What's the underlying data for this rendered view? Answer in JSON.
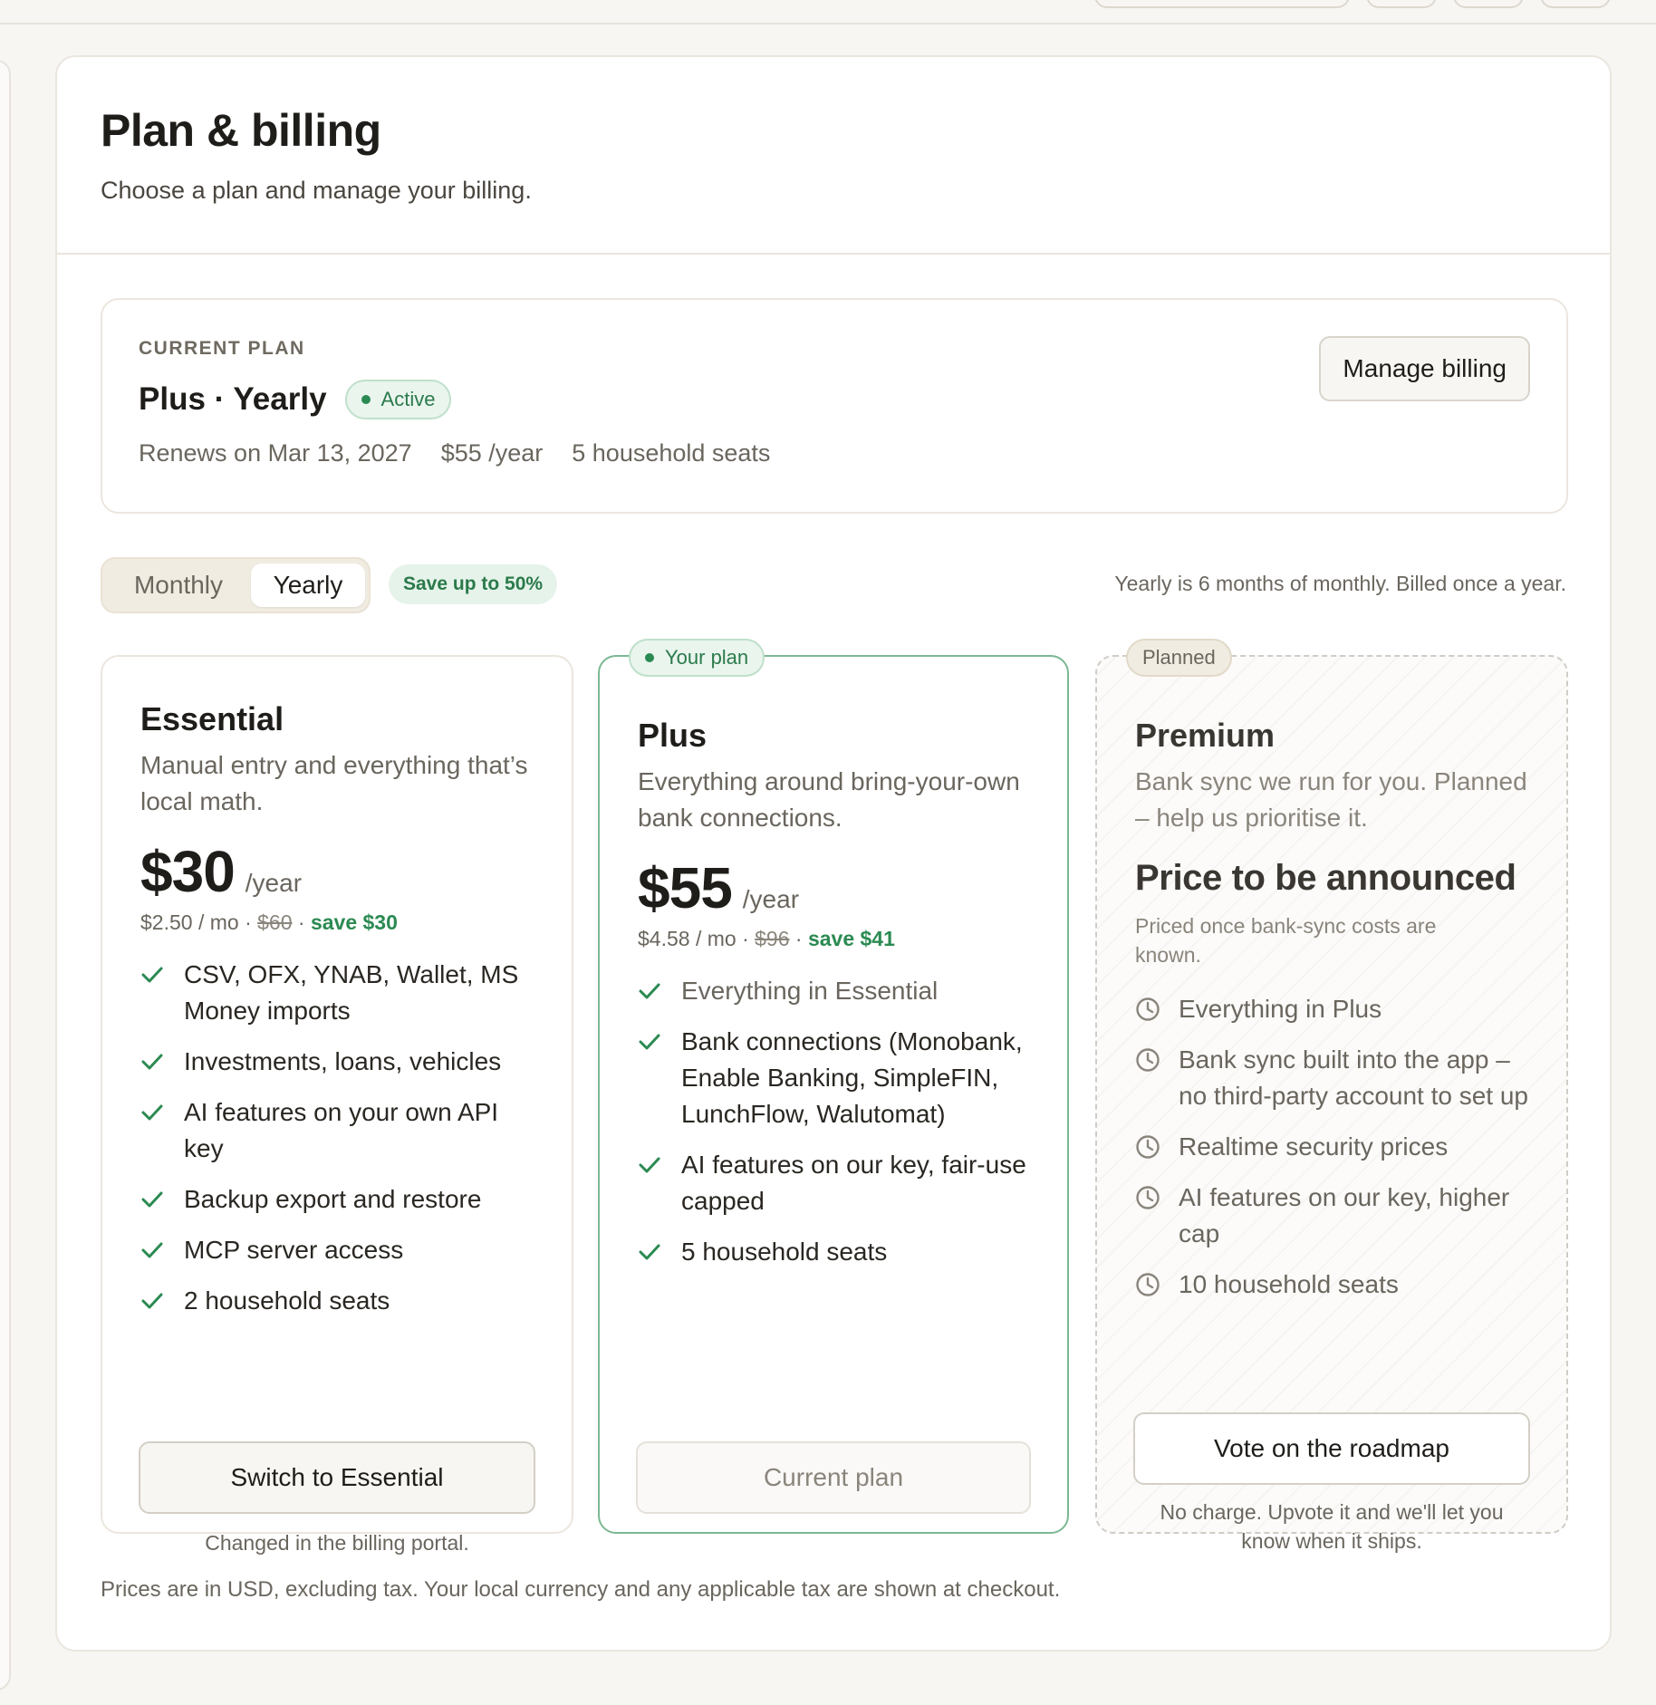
{
  "header": {
    "title": "Plan & billing",
    "subtitle": "Choose a plan and manage your billing."
  },
  "current_plan": {
    "eyebrow": "CURRENT PLAN",
    "name": "Plus · Yearly",
    "status": "Active",
    "renews": "Renews on Mar 13, 2027",
    "price": "$55 /year",
    "seats": "5 household seats",
    "manage_label": "Manage billing"
  },
  "billing_toggle": {
    "options": [
      "Monthly",
      "Yearly"
    ],
    "selected": "Yearly",
    "save_badge": "Save up to 50%",
    "note": "Yearly is 6 months of monthly. Billed once a year."
  },
  "tiers": [
    {
      "name": "Essential",
      "description": "Manual entry and everything that’s local math.",
      "price": "$30",
      "period": "/year",
      "monthly": "$2.50 / mo ·",
      "original": "$60",
      "separator": "·",
      "save": "save $30",
      "features": [
        "CSV, OFX, YNAB, Wallet, MS Money imports",
        "Investments, loans, vehicles",
        "AI features on your own API key",
        "Backup export and restore",
        "MCP server access",
        "2 household seats"
      ],
      "button": "Switch to Essential",
      "footnote": "Changed in the billing portal."
    },
    {
      "tag": "Your plan",
      "name": "Plus",
      "description": "Everything around bring-your-own bank connections.",
      "price": "$55",
      "period": "/year",
      "monthly": "$4.58 / mo ·",
      "original": "$96",
      "separator": "·",
      "save": "save $41",
      "features": [
        "Everything in Essential",
        "Bank connections (Monobank, Enable Banking, SimpleFIN, LunchFlow, Walutomat)",
        "AI features on our key, fair-use capped",
        "5 household seats"
      ],
      "button": "Current plan"
    },
    {
      "tag": "Planned",
      "name": "Premium",
      "description": "Bank sync we run for you. Planned – help us prioritise it.",
      "price_tba": "Price to be announced",
      "price_note": "Priced once bank-sync costs are known.",
      "features": [
        "Everything in Plus",
        "Bank sync built into the app – no third-party account to set up",
        "Realtime security prices",
        "AI features on our key, higher cap",
        "10 household seats"
      ],
      "button": "Vote on the roadmap",
      "footnote": "No charge. Upvote it and we'll let you know when it ships."
    }
  ],
  "footer": {
    "note": "Prices are in USD, excluding tax. Your local currency and any applicable tax are shown at checkout."
  },
  "colors": {
    "accent_green": "#2b8a52",
    "plus_border": "#7bb893",
    "background": "#f7f6f3"
  },
  "icons": {
    "included": "check-icon",
    "planned": "clock-icon"
  }
}
